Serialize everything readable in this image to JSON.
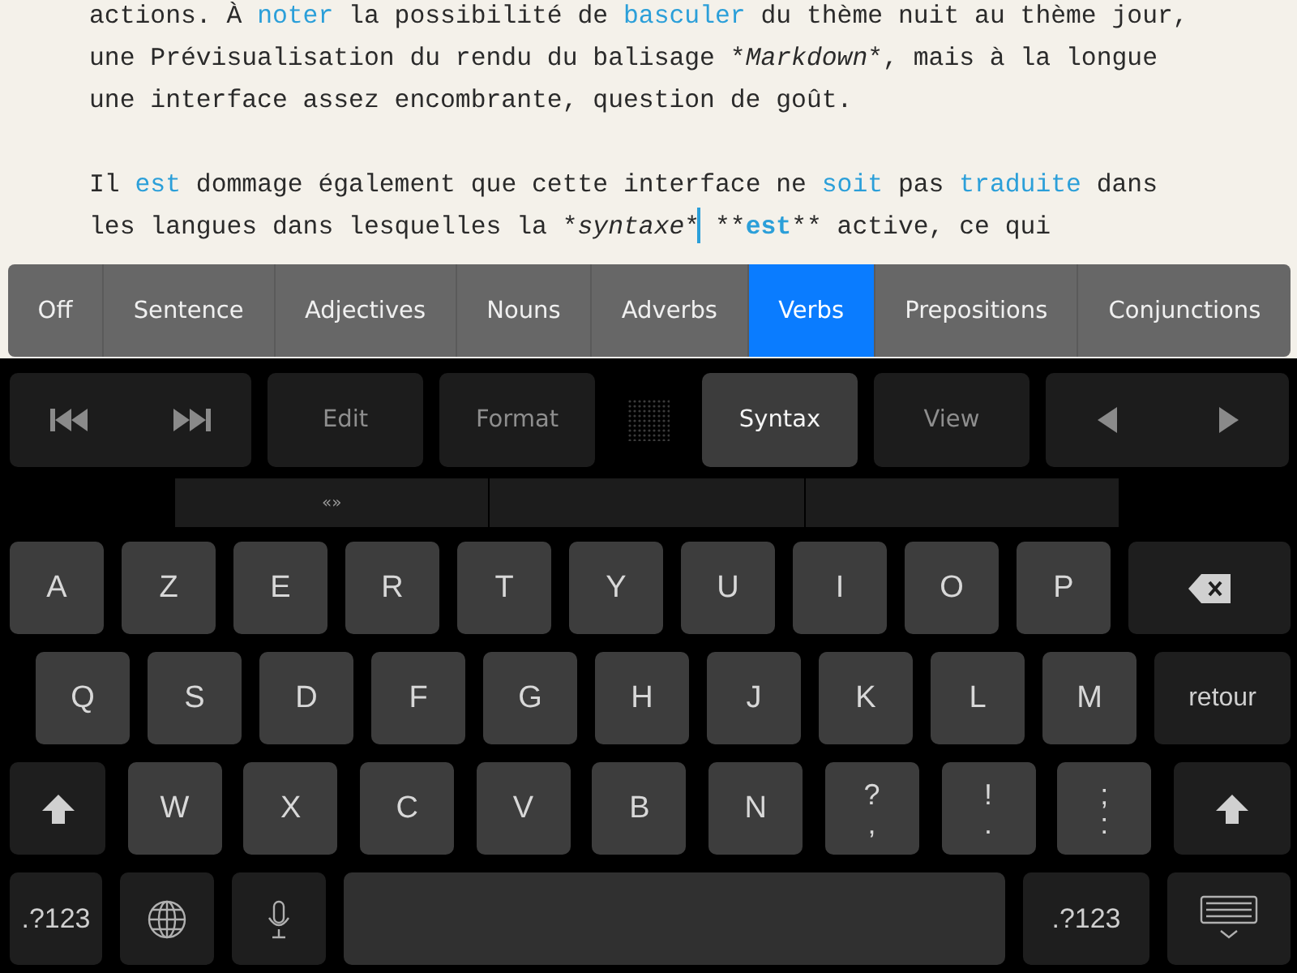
{
  "document": {
    "paragraphs": [
      {
        "lines": [
          [
            {
              "kind": "plain",
              "text": "actions. À "
            },
            {
              "kind": "verb",
              "text": "noter"
            },
            {
              "kind": "plain",
              "text": " la possibilité de "
            },
            {
              "kind": "verb",
              "text": "basculer"
            },
            {
              "kind": "plain",
              "text": " du thème nuit au thème jour,"
            }
          ],
          [
            {
              "kind": "plain",
              "text": "une Prévisualisation du rendu du balisage *"
            },
            {
              "kind": "plain",
              "text": "*Markdown*"
            },
            {
              "kind": "plain",
              "text": "*, mais à la longue"
            }
          ],
          [
            {
              "kind": "plain",
              "text": "une interface assez encombrante, question de goût."
            }
          ]
        ]
      },
      {
        "lines": [
          [
            {
              "kind": "plain",
              "text": "Il "
            },
            {
              "kind": "verb",
              "text": "est"
            },
            {
              "kind": "plain",
              "text": " dommage également que cette interface ne "
            },
            {
              "kind": "verb",
              "text": "soit"
            },
            {
              "kind": "plain",
              "text": " pas "
            },
            {
              "kind": "verb",
              "text": "traduite"
            },
            {
              "kind": "plain",
              "text": " dans"
            }
          ],
          [
            {
              "kind": "plain",
              "text": "les langues dans lesquelles la *"
            },
            {
              "kind": "plain",
              "text": "*syntaxe*"
            },
            {
              "kind": "caret",
              "text": "* **"
            },
            {
              "kind": "verb",
              "text": "**est**"
            },
            {
              "kind": "plain",
              "text": "** active, ce qui"
            }
          ]
        ]
      }
    ]
  },
  "syntax_bar": [
    {
      "label": "Off",
      "selected": false
    },
    {
      "label": "Sentence",
      "selected": false
    },
    {
      "label": "Adjectives",
      "selected": false
    },
    {
      "label": "Nouns",
      "selected": false
    },
    {
      "label": "Adverbs",
      "selected": false
    },
    {
      "label": "Verbs",
      "selected": true
    },
    {
      "label": "Prepositions",
      "selected": false
    },
    {
      "label": "Conjunctions",
      "selected": false
    }
  ],
  "toolbar": [
    {
      "kind": "transport"
    },
    {
      "kind": "button",
      "label": "Edit",
      "selected": false
    },
    {
      "kind": "button",
      "label": "Format",
      "selected": false
    },
    {
      "kind": "grip"
    },
    {
      "kind": "button",
      "label": "Syntax",
      "selected": true
    },
    {
      "kind": "button",
      "label": "View",
      "selected": false
    },
    {
      "kind": "arrows"
    }
  ],
  "suggestions": [
    "«»"
  ],
  "keys": [
    [
      {
        "kind": "letter",
        "label": "A"
      },
      {
        "kind": "letter",
        "label": "Z"
      },
      {
        "kind": "letter",
        "label": "E"
      },
      {
        "kind": "letter",
        "label": "R"
      },
      {
        "kind": "letter",
        "label": "T"
      },
      {
        "kind": "letter",
        "label": "Y"
      },
      {
        "kind": "letter",
        "label": "U"
      },
      {
        "kind": "letter",
        "label": "I"
      },
      {
        "kind": "letter",
        "label": "O"
      },
      {
        "kind": "letter",
        "label": "P"
      },
      {
        "kind": "backspace"
      }
    ],
    [
      {
        "kind": "letter",
        "label": "Q"
      },
      {
        "kind": "letter",
        "label": "S"
      },
      {
        "kind": "letter",
        "label": "D"
      },
      {
        "kind": "letter",
        "label": "F"
      },
      {
        "kind": "letter",
        "label": "G"
      },
      {
        "kind": "letter",
        "label": "H"
      },
      {
        "kind": "letter",
        "label": "J"
      },
      {
        "kind": "letter",
        "label": "K"
      },
      {
        "kind": "letter",
        "label": "L"
      },
      {
        "kind": "letter",
        "label": "M"
      },
      {
        "kind": "return",
        "label": "retour"
      }
    ],
    [
      {
        "kind": "shift"
      },
      {
        "kind": "letter",
        "label": "W"
      },
      {
        "kind": "letter",
        "label": "X"
      },
      {
        "kind": "letter",
        "label": "C"
      },
      {
        "kind": "letter",
        "label": "V"
      },
      {
        "kind": "letter",
        "label": "B"
      },
      {
        "kind": "letter",
        "label": "N"
      },
      {
        "kind": "punct",
        "top": "?",
        "bottom": ","
      },
      {
        "kind": "punct",
        "top": "!",
        "bottom": "."
      },
      {
        "kind": "punct",
        "top": ";",
        "bottom": ":"
      },
      {
        "kind": "shift"
      }
    ],
    [
      {
        "kind": "mode",
        "label": ".?123"
      },
      {
        "kind": "globe"
      },
      {
        "kind": "mic"
      },
      {
        "kind": "space"
      },
      {
        "kind": "mode",
        "label": ".?123"
      },
      {
        "kind": "hide"
      }
    ]
  ]
}
